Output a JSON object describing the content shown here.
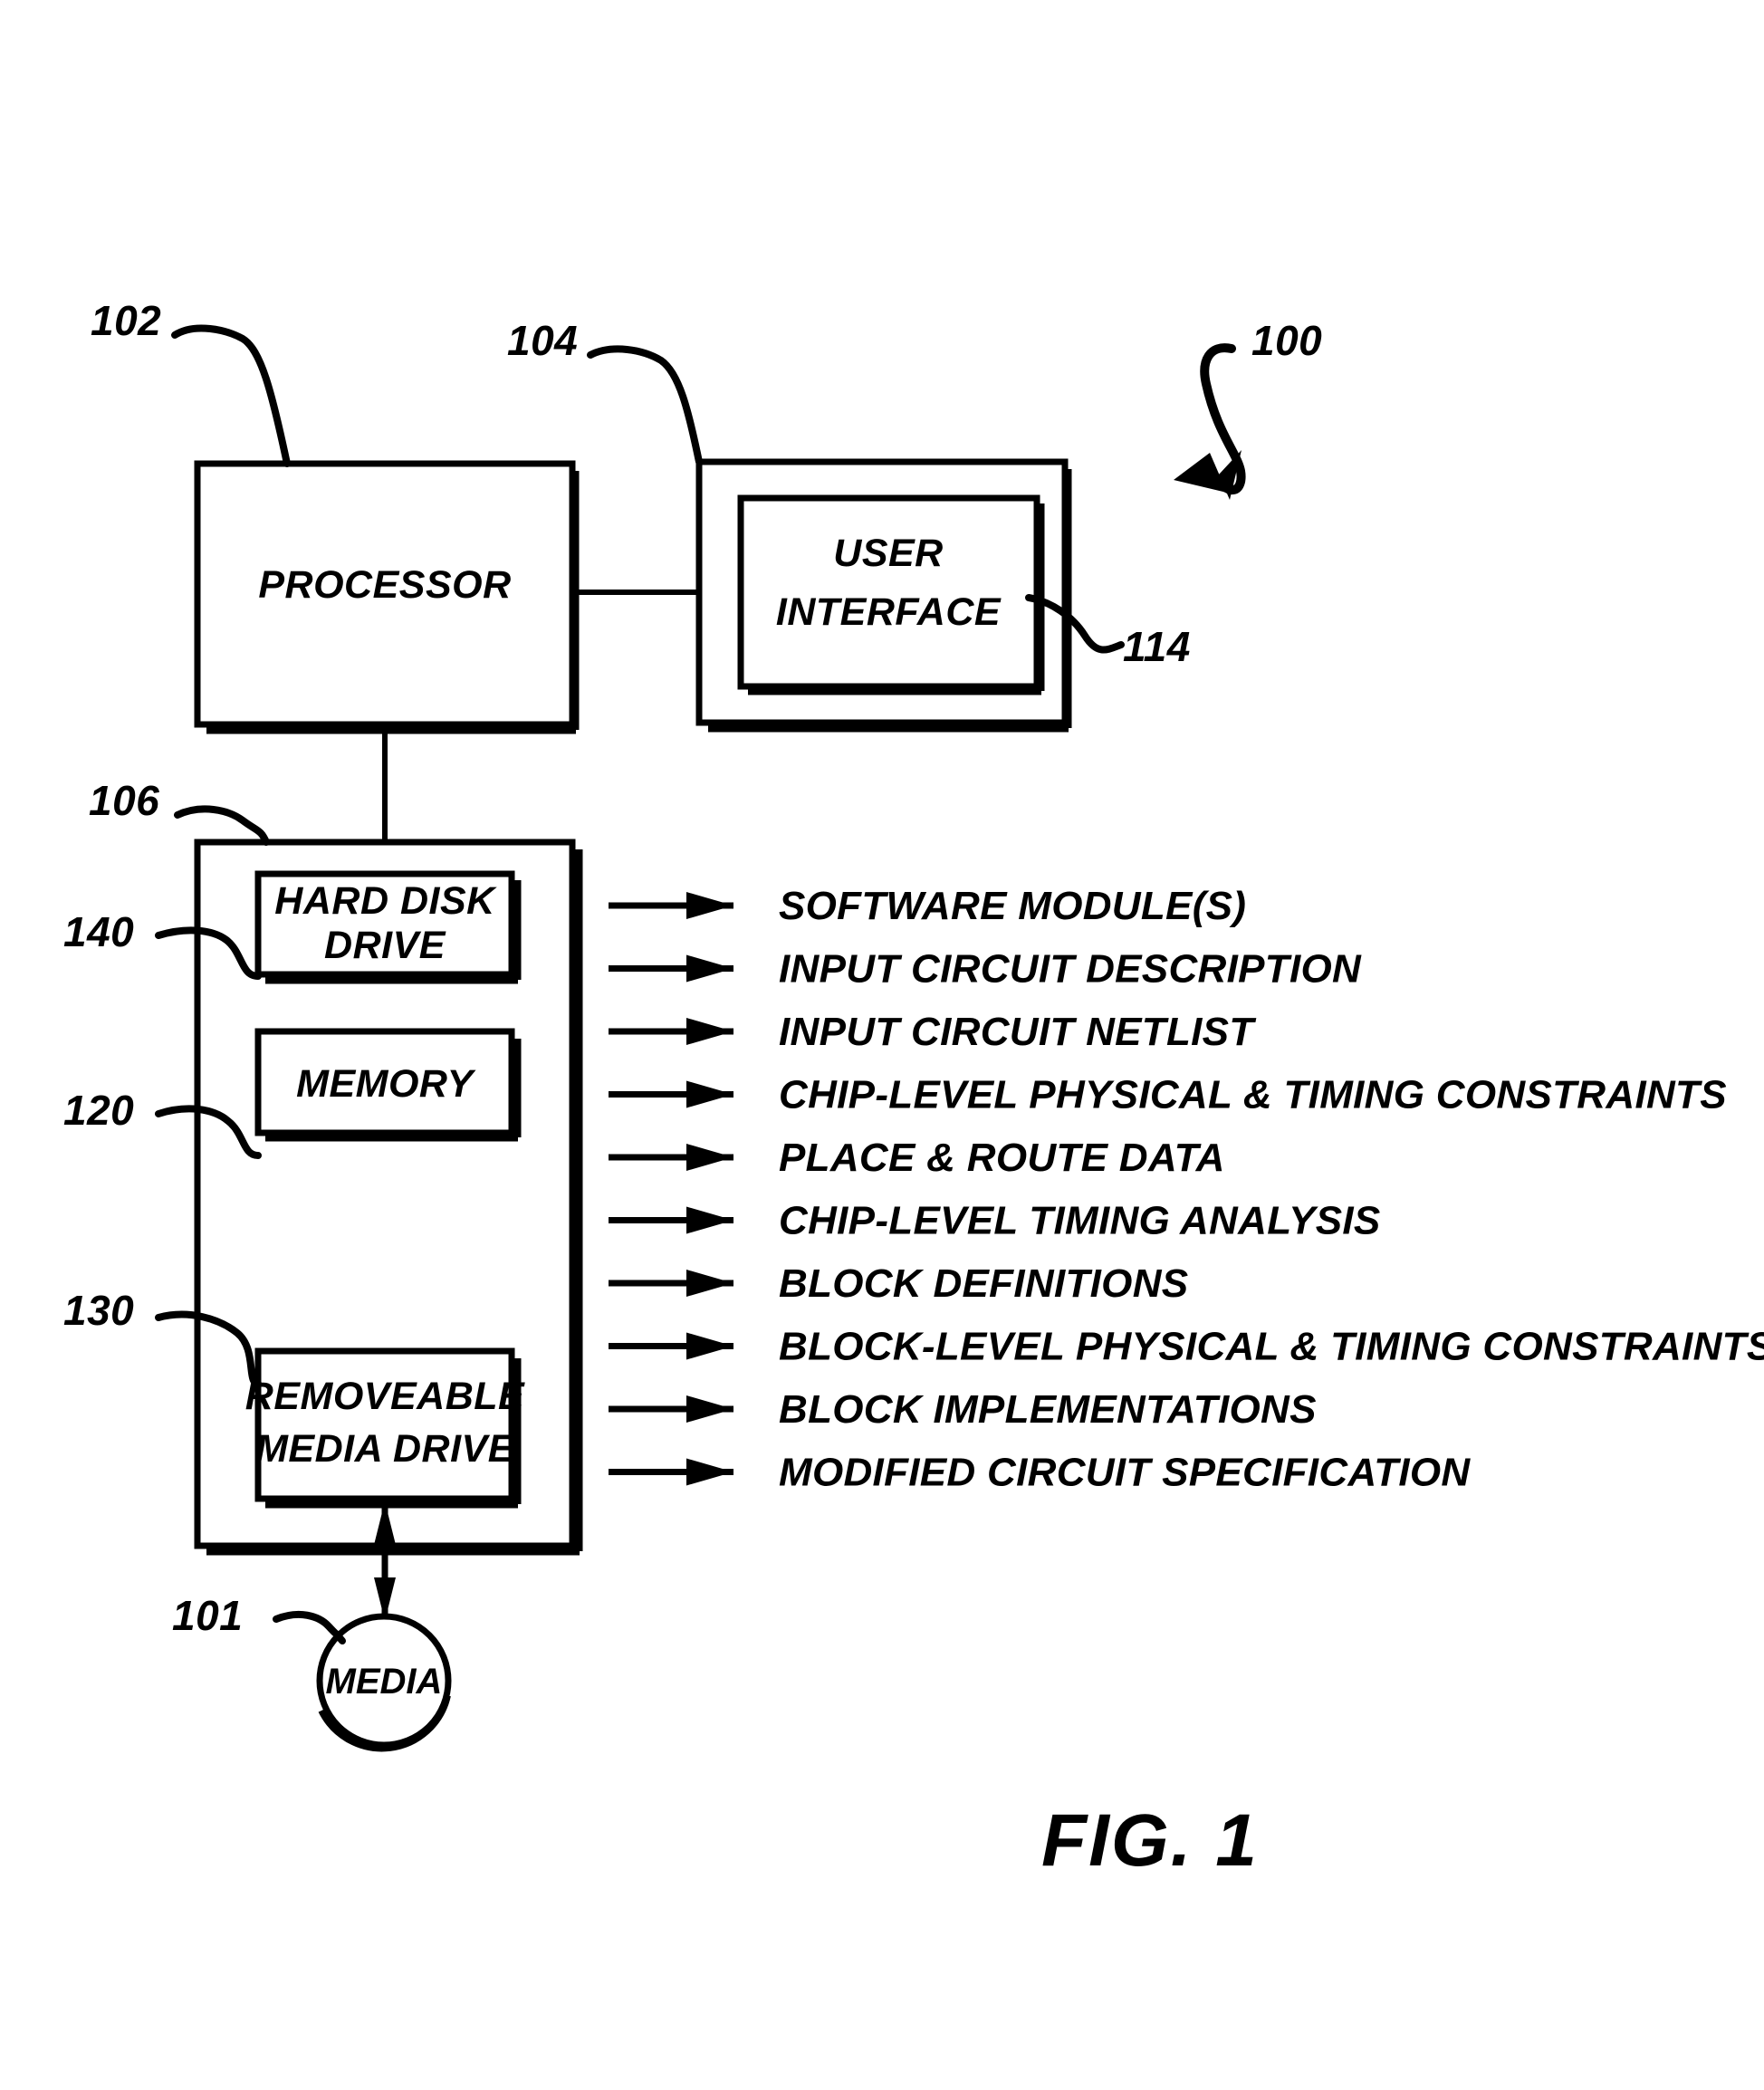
{
  "figure": {
    "caption": "FIG. 1",
    "system_ref": "100"
  },
  "blocks": {
    "processor": {
      "label": "PROCESSOR",
      "ref": "102"
    },
    "user_interface_enclosure": {
      "ref": "104"
    },
    "user_interface": {
      "label_line1": "USER",
      "label_line2": "INTERFACE",
      "ref": "114"
    },
    "storage_enclosure": {
      "ref": "106"
    },
    "hard_disk_drive": {
      "label_line1": "HARD DISK",
      "label_line2": "DRIVE",
      "ref": "140"
    },
    "memory": {
      "label": "MEMORY",
      "ref": "120"
    },
    "removeable_media_drive": {
      "label_line1": "REMOVEABLE",
      "label_line2": "MEDIA DRIVE",
      "ref": "130"
    },
    "media": {
      "label": "MEDIA",
      "ref": "101"
    }
  },
  "stored_items": [
    "SOFTWARE MODULE(S)",
    "INPUT CIRCUIT DESCRIPTION",
    "INPUT CIRCUIT NETLIST",
    "CHIP-LEVEL PHYSICAL & TIMING CONSTRAINTS",
    "PLACE & ROUTE DATA",
    "CHIP-LEVEL TIMING ANALYSIS",
    "BLOCK DEFINITIONS",
    "BLOCK-LEVEL PHYSICAL & TIMING CONSTRAINTS",
    "BLOCK IMPLEMENTATIONS",
    "MODIFIED CIRCUIT SPECIFICATION"
  ],
  "colors": {
    "ink": "#000000",
    "paper": "#ffffff"
  }
}
